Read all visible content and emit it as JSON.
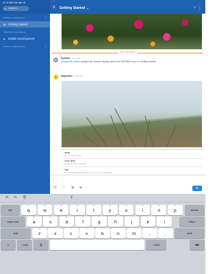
{
  "status_bar": {
    "time": "11:24 AM",
    "day": "Tue Jan 16",
    "battery": "100%"
  },
  "sidebar": {
    "search_placeholder": "Jump to...",
    "public_channels_label": "PUBLIC CHANNELS",
    "channels": [
      {
        "label": "Getting Started",
        "active": true
      }
    ],
    "private_channels_label": "PRIVATE CHANNELS",
    "private_channels": [
      {
        "label": "Mobile Development",
        "active": false
      }
    ],
    "direct_messages_label": "DIRECT MESSAGES"
  },
  "header": {
    "channel_title": "Getting Started ⌄"
  },
  "feed": {
    "new_messages_label": "New Messages",
    "system_post": {
      "author": "System",
      "time": "11:23 AM",
      "mention": "@sysadmin_admin",
      "text": " updated the channel display name from: MPHNB Forum to: Getting Started"
    },
    "user_post": {
      "author": "alejandro",
      "time": "11:23 AM",
      "avatar_letter": "a"
    }
  },
  "slash_commands": [
    {
      "command": "/away",
      "description": "Set your status away"
    },
    {
      "command": "/code {text}",
      "description": "Display text as a code block"
    },
    {
      "command": "/dnd",
      "description": "Do not disturb disables desktop and mobile push notifications"
    },
    {
      "command": "/echo \"message\" [delay in seconds]",
      "description": ""
    }
  ],
  "composer": {
    "value": "/",
    "send_icon": "send-icon"
  },
  "keyboard": {
    "toolbar": {
      "undo": "↶",
      "redo": "↷",
      "paste": "⎘",
      "format": "⍒"
    },
    "row1": [
      {
        "main": "q",
        "alt": "1"
      },
      {
        "main": "w",
        "alt": "2"
      },
      {
        "main": "e",
        "alt": "3"
      },
      {
        "main": "r",
        "alt": "4"
      },
      {
        "main": "t",
        "alt": "5"
      },
      {
        "main": "y",
        "alt": "6"
      },
      {
        "main": "u",
        "alt": "7"
      },
      {
        "main": "i",
        "alt": "8"
      },
      {
        "main": "o",
        "alt": "9"
      },
      {
        "main": "p",
        "alt": "0"
      }
    ],
    "row2": [
      {
        "main": "a",
        "alt": "@"
      },
      {
        "main": "s",
        "alt": "#"
      },
      {
        "main": "d",
        "alt": "$"
      },
      {
        "main": "f",
        "alt": "&"
      },
      {
        "main": "g",
        "alt": "*"
      },
      {
        "main": "h",
        "alt": "("
      },
      {
        "main": "j",
        "alt": ")"
      },
      {
        "main": "k",
        "alt": "'"
      },
      {
        "main": "l",
        "alt": "\""
      }
    ],
    "row3": [
      {
        "main": "z",
        "alt": "%"
      },
      {
        "main": "x",
        "alt": "-"
      },
      {
        "main": "c",
        "alt": "+"
      },
      {
        "main": "v",
        "alt": "="
      },
      {
        "main": "b",
        "alt": "/"
      },
      {
        "main": "n",
        "alt": ";"
      },
      {
        "main": "m",
        "alt": ":"
      },
      {
        "main": ",",
        "alt": "!"
      },
      {
        "main": ".",
        "alt": "?"
      }
    ],
    "delete_label": "delete",
    "tab_label": "tab",
    "caps_label": "caps lock",
    "return_label": "return",
    "shift_label": "shift",
    "numbers_label": ".?123",
    "emoji_label": "☺",
    "mic_label": "🎙",
    "hide_label": "⌨"
  }
}
